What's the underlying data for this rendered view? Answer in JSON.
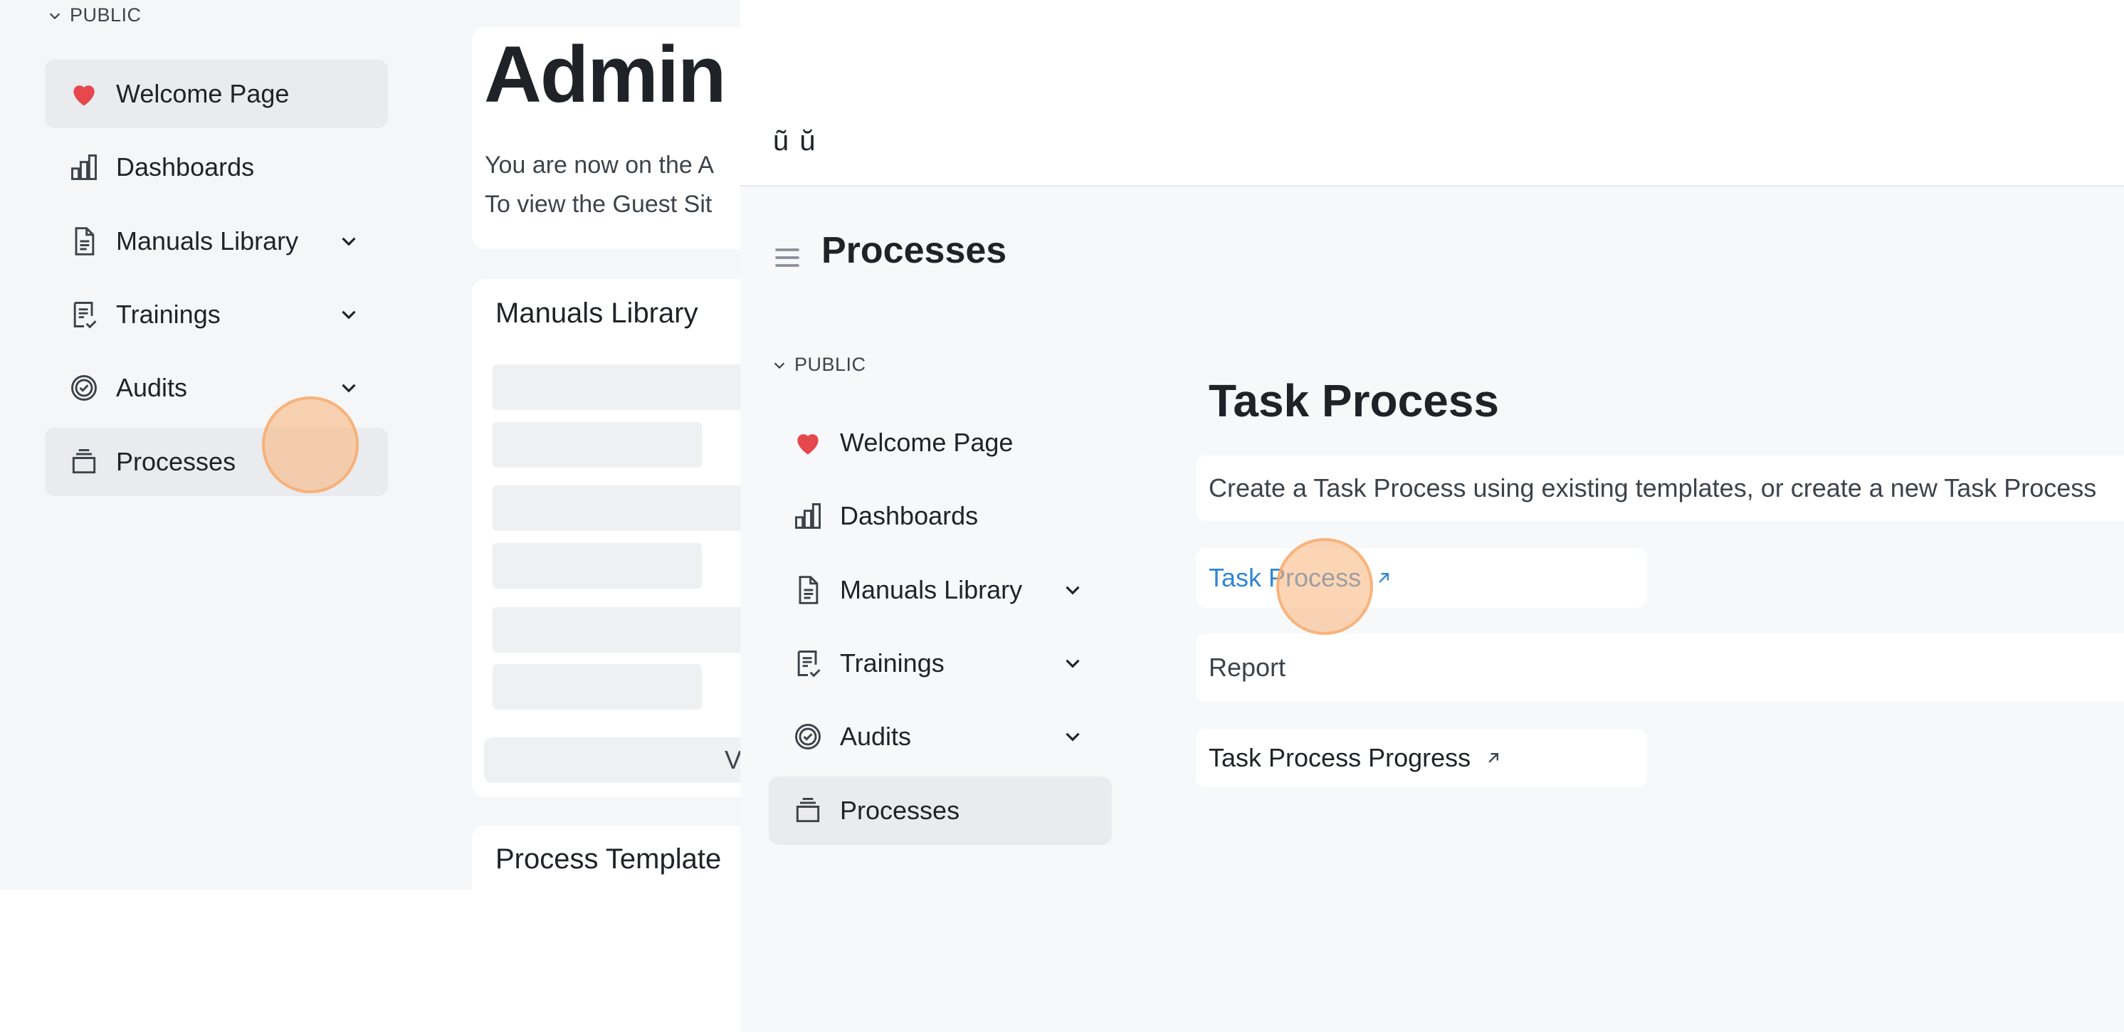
{
  "colors": {
    "accent_link": "#2f86d6",
    "heart": "#e5484d",
    "active_bg": "#e9ebee",
    "click_marker": "#fab278"
  },
  "back_window": {
    "sidebar": {
      "section_label": "PUBLIC",
      "items": [
        {
          "label": "Welcome Page",
          "icon": "heart-icon",
          "active": true
        },
        {
          "label": "Dashboards",
          "icon": "bar-chart-icon"
        },
        {
          "label": "Manuals Library",
          "icon": "document-icon",
          "has_chevron": true
        },
        {
          "label": "Trainings",
          "icon": "checklist-icon",
          "has_chevron": true
        },
        {
          "label": "Audits",
          "icon": "badge-check-icon",
          "has_chevron": true
        },
        {
          "label": "Processes",
          "icon": "tray-icon",
          "active": true
        }
      ]
    },
    "main": {
      "title": "Admin Site",
      "text_line1": "You are now on the A",
      "text_line2": "To view the Guest Sit",
      "manuals_card_title": "Manuals Library",
      "view_button_fragment": "V",
      "process_templates_title": "Process Template"
    }
  },
  "front_window": {
    "header_fragment": "ũ ŭ",
    "page_title": "Processes",
    "sidebar": {
      "section_label": "PUBLIC",
      "items": [
        {
          "label": "Welcome Page",
          "icon": "heart-icon"
        },
        {
          "label": "Dashboards",
          "icon": "bar-chart-icon"
        },
        {
          "label": "Manuals Library",
          "icon": "document-icon",
          "has_chevron": true
        },
        {
          "label": "Trainings",
          "icon": "checklist-icon",
          "has_chevron": true
        },
        {
          "label": "Audits",
          "icon": "badge-check-icon",
          "has_chevron": true
        },
        {
          "label": "Processes",
          "icon": "tray-icon",
          "active": true
        }
      ]
    },
    "content": {
      "heading": "Task Process",
      "description": "Create a Task Process using existing templates, or create a new Task Process",
      "task_process_link": "Task Process",
      "report_label": "Report",
      "progress_link": "Task Process Progress"
    }
  }
}
